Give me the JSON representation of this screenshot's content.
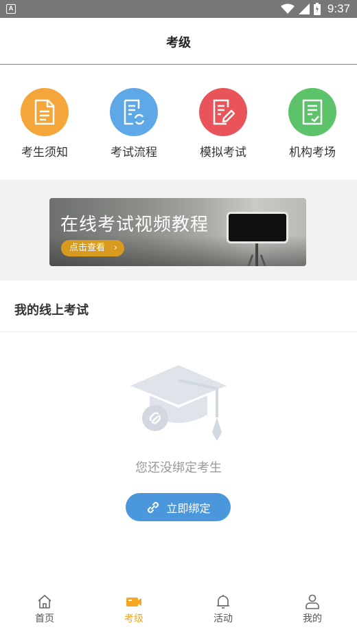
{
  "status_bar": {
    "notification_icon": "A",
    "time": "9:37",
    "icons": [
      "wifi-icon",
      "signal-icon",
      "battery-icon"
    ]
  },
  "header": {
    "title": "考级"
  },
  "quick_menu": [
    {
      "label": "考生须知",
      "icon": "document-icon",
      "color": "#f5a63a"
    },
    {
      "label": "考试流程",
      "icon": "process-document-icon",
      "color": "#5fa8e8"
    },
    {
      "label": "模拟考试",
      "icon": "edit-document-icon",
      "color": "#e8545a"
    },
    {
      "label": "机构考场",
      "icon": "checklist-icon",
      "color": "#5cc36b"
    }
  ],
  "banner": {
    "headline": "在线考试视频教程",
    "cta": "点击查看"
  },
  "section": {
    "title": "我的线上考试"
  },
  "empty_state": {
    "message": "您还没绑定考生",
    "button": "立即绑定",
    "illustration": "graduation-cap-icon"
  },
  "tabs": [
    {
      "label": "首页",
      "icon": "home-icon",
      "active": false
    },
    {
      "label": "考级",
      "icon": "camera-icon",
      "active": true
    },
    {
      "label": "活动",
      "icon": "bell-icon",
      "active": false
    },
    {
      "label": "我的",
      "icon": "user-icon",
      "active": false
    }
  ],
  "colors": {
    "accent": "#f5a623",
    "primary_blue": "#4b97dc"
  }
}
